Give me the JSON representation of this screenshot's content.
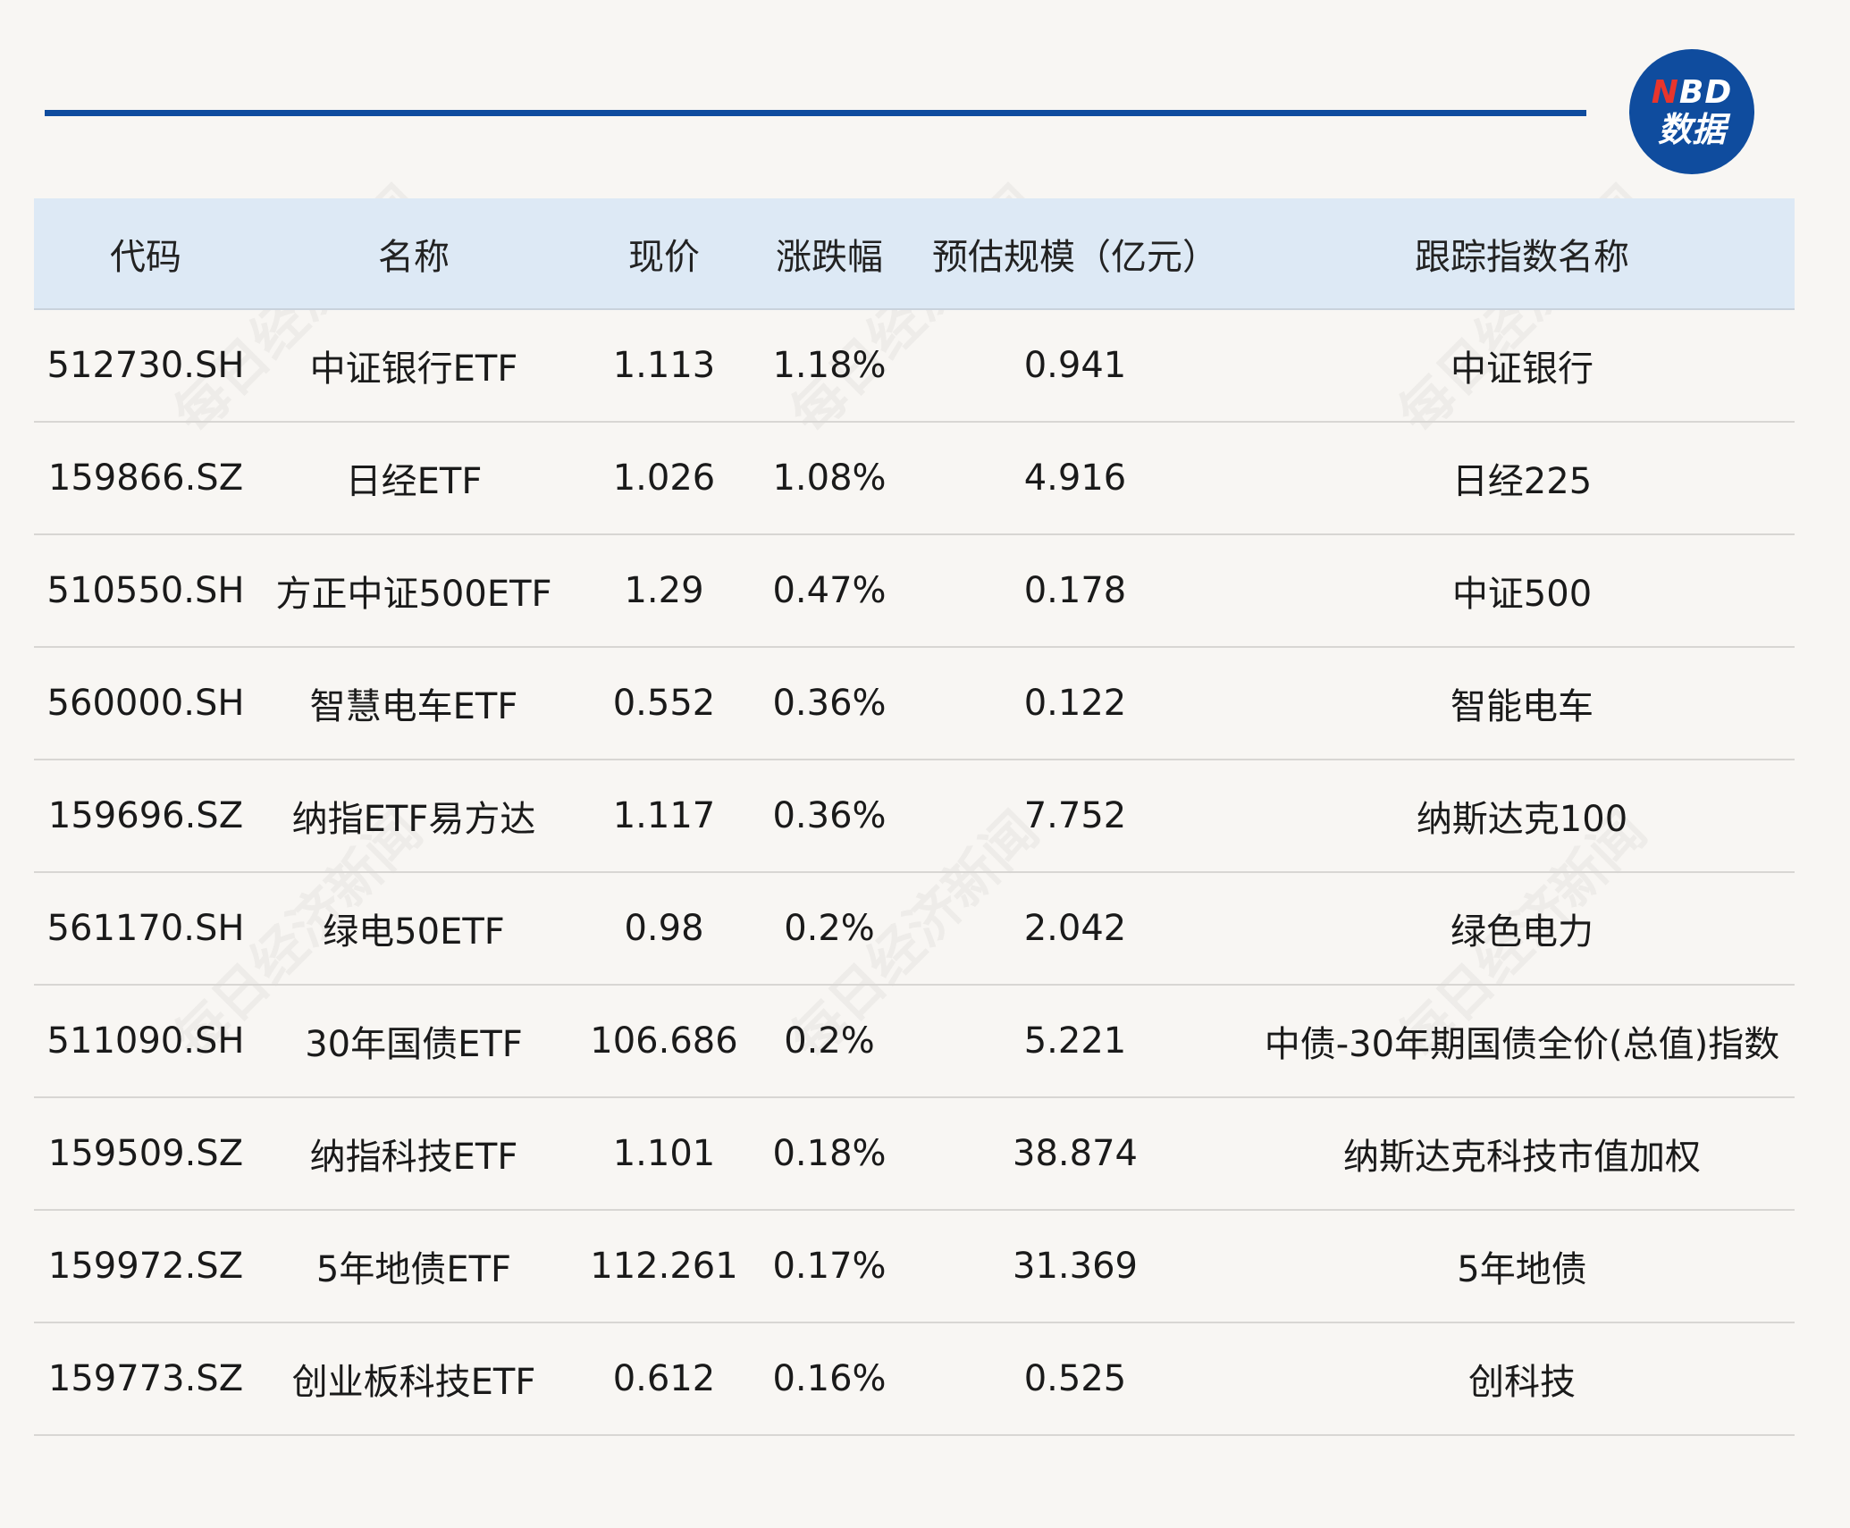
{
  "brand": {
    "logo_line1": "NBD",
    "logo_line2": "数据",
    "accent": "#0f4c9e",
    "logo_n_color": "#e8352c"
  },
  "watermark": "每日经济新闻",
  "table": {
    "headers": [
      "代码",
      "名称",
      "现价",
      "涨跌幅",
      "预估规模（亿元）",
      "跟踪指数名称"
    ],
    "rows": [
      [
        "512730.SH",
        "中证银行ETF",
        "1.113",
        "1.18%",
        "0.941",
        "中证银行"
      ],
      [
        "159866.SZ",
        "日经ETF",
        "1.026",
        "1.08%",
        "4.916",
        "日经225"
      ],
      [
        "510550.SH",
        "方正中证500ETF",
        "1.29",
        "0.47%",
        "0.178",
        "中证500"
      ],
      [
        "560000.SH",
        "智慧电车ETF",
        "0.552",
        "0.36%",
        "0.122",
        "智能电车"
      ],
      [
        "159696.SZ",
        "纳指ETF易方达",
        "1.117",
        "0.36%",
        "7.752",
        "纳斯达克100"
      ],
      [
        "561170.SH",
        "绿电50ETF",
        "0.98",
        "0.2%",
        "2.042",
        "绿色电力"
      ],
      [
        "511090.SH",
        "30年国债ETF",
        "106.686",
        "0.2%",
        "5.221",
        "中债-30年期国债全价(总值)指数"
      ],
      [
        "159509.SZ",
        "纳指科技ETF",
        "1.101",
        "0.18%",
        "38.874",
        "纳斯达克科技市值加权"
      ],
      [
        "159972.SZ",
        "5年地债ETF",
        "112.261",
        "0.17%",
        "31.369",
        "5年地债"
      ],
      [
        "159773.SZ",
        "创业板科技ETF",
        "0.612",
        "0.16%",
        "0.525",
        "创科技"
      ]
    ]
  }
}
